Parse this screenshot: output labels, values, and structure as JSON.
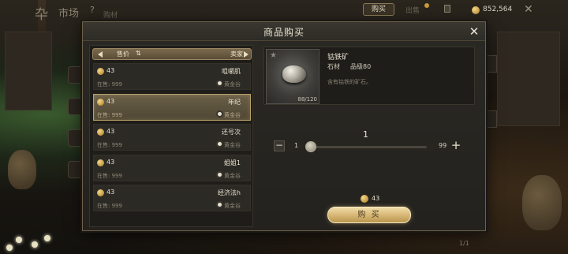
{
  "topbar": {
    "logo": "卆",
    "title": "市场",
    "help": "?",
    "subtitle": "购材",
    "tab_buy": "购买",
    "tab_sell": "出售",
    "gold": "852,564"
  },
  "dialog": {
    "title": "商品购买",
    "list_header": {
      "price_label": "售价",
      "sort_icon": "⇅",
      "seller_label": "卖家"
    },
    "listings": [
      {
        "price": "43",
        "name": "咀嚼肌",
        "stock": "在售: 999",
        "seller": "黄金谷"
      },
      {
        "price": "43",
        "name": "年纪",
        "stock": "在售: 999",
        "seller": "黄金谷"
      },
      {
        "price": "43",
        "name": "还号次",
        "stock": "在售: 999",
        "seller": "黄金谷"
      },
      {
        "price": "43",
        "name": "姐姐1",
        "stock": "在售: 999",
        "seller": "黄金谷"
      },
      {
        "price": "43",
        "name": "经济法h",
        "stock": "在售: 999",
        "seller": "黄金谷"
      }
    ],
    "selected_index": 1,
    "item": {
      "name": "钴铁矿",
      "type": "石材",
      "grade": "品级80",
      "description": "含有钴铁的矿石。",
      "quantity_owned": "88/120"
    },
    "quantity": {
      "current": "1",
      "min": "1",
      "max": "99",
      "fraction": 0
    },
    "total": "43",
    "buy_label": "购 买"
  },
  "pager": "1/1",
  "colors": {
    "accent_gold": "#d8b878",
    "selected_row": "#6a6048",
    "panel": "#1f1d19"
  },
  "icons": [
    "close-icon",
    "coin-icon",
    "star-icon",
    "minus-icon",
    "plus-icon",
    "sort-icon",
    "seller-icon"
  ]
}
